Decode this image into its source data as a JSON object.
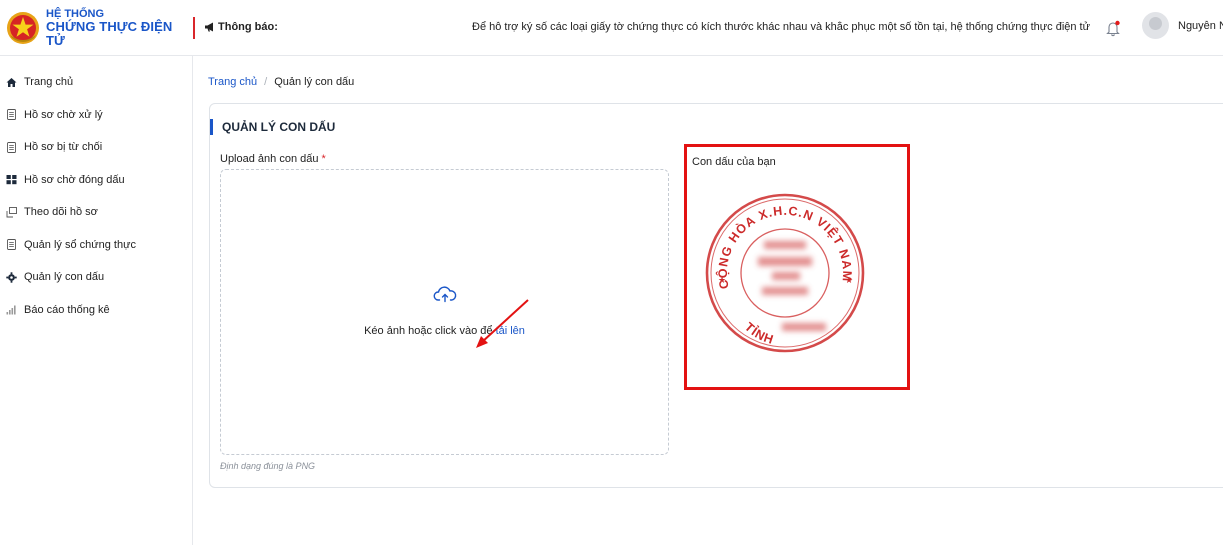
{
  "header": {
    "brand_line1": "HỆ THỐNG",
    "brand_line2": "CHỨNG THỰC ĐIỆN TỬ",
    "notice_label": "Thông báo:",
    "notice_text": "Để hỗ trợ ký số các loại giấy tờ chứng thực có kích thước khác nhau và khắc phục một số tồn tại, hệ thống chứng thực điện tử",
    "user_name": "Nguyễn N",
    "icons": [
      "emblem-icon",
      "megaphone-icon",
      "bell-icon",
      "avatar"
    ]
  },
  "sidebar": {
    "items": [
      {
        "label": "Trang chủ",
        "icon": "home-icon"
      },
      {
        "label": "Hồ sơ chờ xử lý",
        "icon": "document-icon"
      },
      {
        "label": "Hồ sơ bị từ chối",
        "icon": "document-icon"
      },
      {
        "label": "Hồ sơ chờ đóng dấu",
        "icon": "grid-icon"
      },
      {
        "label": "Theo dõi hồ sơ",
        "icon": "track-icon"
      },
      {
        "label": "Quản lý sổ chứng thực",
        "icon": "document-icon"
      },
      {
        "label": "Quản lý con dấu",
        "icon": "gear-icon"
      },
      {
        "label": "Báo cáo thống kê",
        "icon": "bar-chart-icon"
      }
    ]
  },
  "breadcrumb": {
    "home": "Trang chủ",
    "separator": "/",
    "current": "Quản lý con dấu"
  },
  "card": {
    "title": "QUẢN LÝ CON DẤU",
    "upload_label": "Upload ảnh con dấu",
    "required_mark": "*",
    "drop_text": "Kéo ảnh hoặc click vào để",
    "drop_link": "tải lên",
    "format_hint": "Định dạng đúng là PNG",
    "stamp_label": "Con dấu của bạn"
  },
  "stamp": {
    "text_top": "CỘNG HÒA X.H.C.N VIỆT NAM",
    "text_bottom": "TỈNH",
    "color": "#cc2a2a"
  },
  "colors": {
    "brand": "#1a56c8",
    "accent_red": "#d9262b",
    "highlight_box": "#e31212"
  }
}
